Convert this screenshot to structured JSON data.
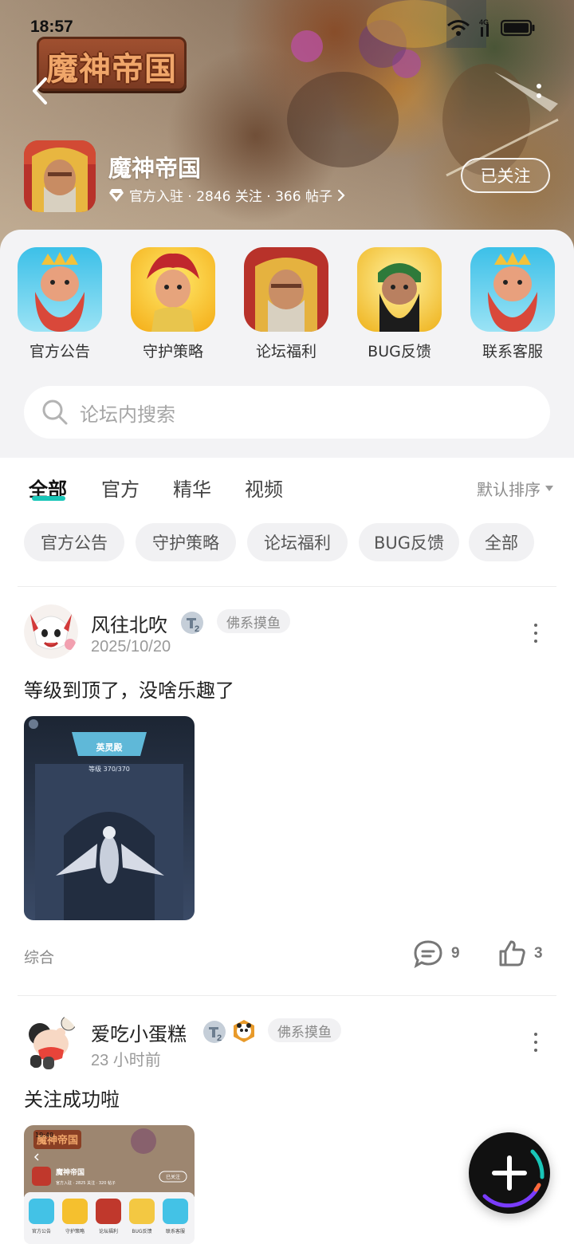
{
  "status_bar": {
    "time": "18:57",
    "network": "4G",
    "icons": [
      "wifi-icon",
      "signal-icon",
      "battery-icon"
    ]
  },
  "header": {
    "logo_text": "魔神帝国",
    "forum_name": "魔神帝国",
    "meta": "官方入驻 · 2846 关注 · 366 帖子",
    "follow_label": "已关注",
    "icons": [
      "back-icon",
      "more-icon",
      "diamond-icon",
      "chevron-right-icon"
    ]
  },
  "entries": [
    {
      "label": "官方公告",
      "icon": "bearded-king-icon"
    },
    {
      "label": "守护策略",
      "icon": "red-hair-hero-icon"
    },
    {
      "label": "论坛福利",
      "icon": "warrior-king-icon"
    },
    {
      "label": "BUG反馈",
      "icon": "black-beard-general-icon"
    },
    {
      "label": "联系客服",
      "icon": "bearded-king-icon"
    }
  ],
  "search": {
    "placeholder": "论坛内搜索"
  },
  "tabs": [
    {
      "label": "全部",
      "active": true
    },
    {
      "label": "官方",
      "active": false
    },
    {
      "label": "精华",
      "active": false
    },
    {
      "label": "视频",
      "active": false
    }
  ],
  "sort_label": "默认排序",
  "chips": [
    "官方公告",
    "守护策略",
    "论坛福利",
    "BUG反馈",
    "全部"
  ],
  "posts": [
    {
      "user": "风往北吹",
      "level": "2",
      "tag": "佛系摸鱼",
      "time": "2025/10/20",
      "content": "等级到顶了，没啥乐趣了",
      "image_title": "英灵殿",
      "image_sub": "等级 370/370",
      "category": "综合",
      "comments": "9",
      "likes": "3"
    },
    {
      "user": "爱吃小蛋糕",
      "level": "2",
      "tag": "佛系摸鱼",
      "time": "23 小时前",
      "content": "关注成功啦",
      "image_time": "19:40",
      "image_forum": "魔神帝国",
      "image_meta": "官方入驻 · 2825 关注 · 320 帖子",
      "image_follow": "已关注",
      "image_entries": [
        "官方公告",
        "守护策略",
        "论坛福利",
        "BUG反馈",
        "联系客服"
      ]
    }
  ],
  "fab_icon": "plus-icon",
  "colors": {
    "accent": "#19c6b8",
    "chip_bg": "#f1f1f3",
    "panel_bg": "#f3f3f5"
  }
}
